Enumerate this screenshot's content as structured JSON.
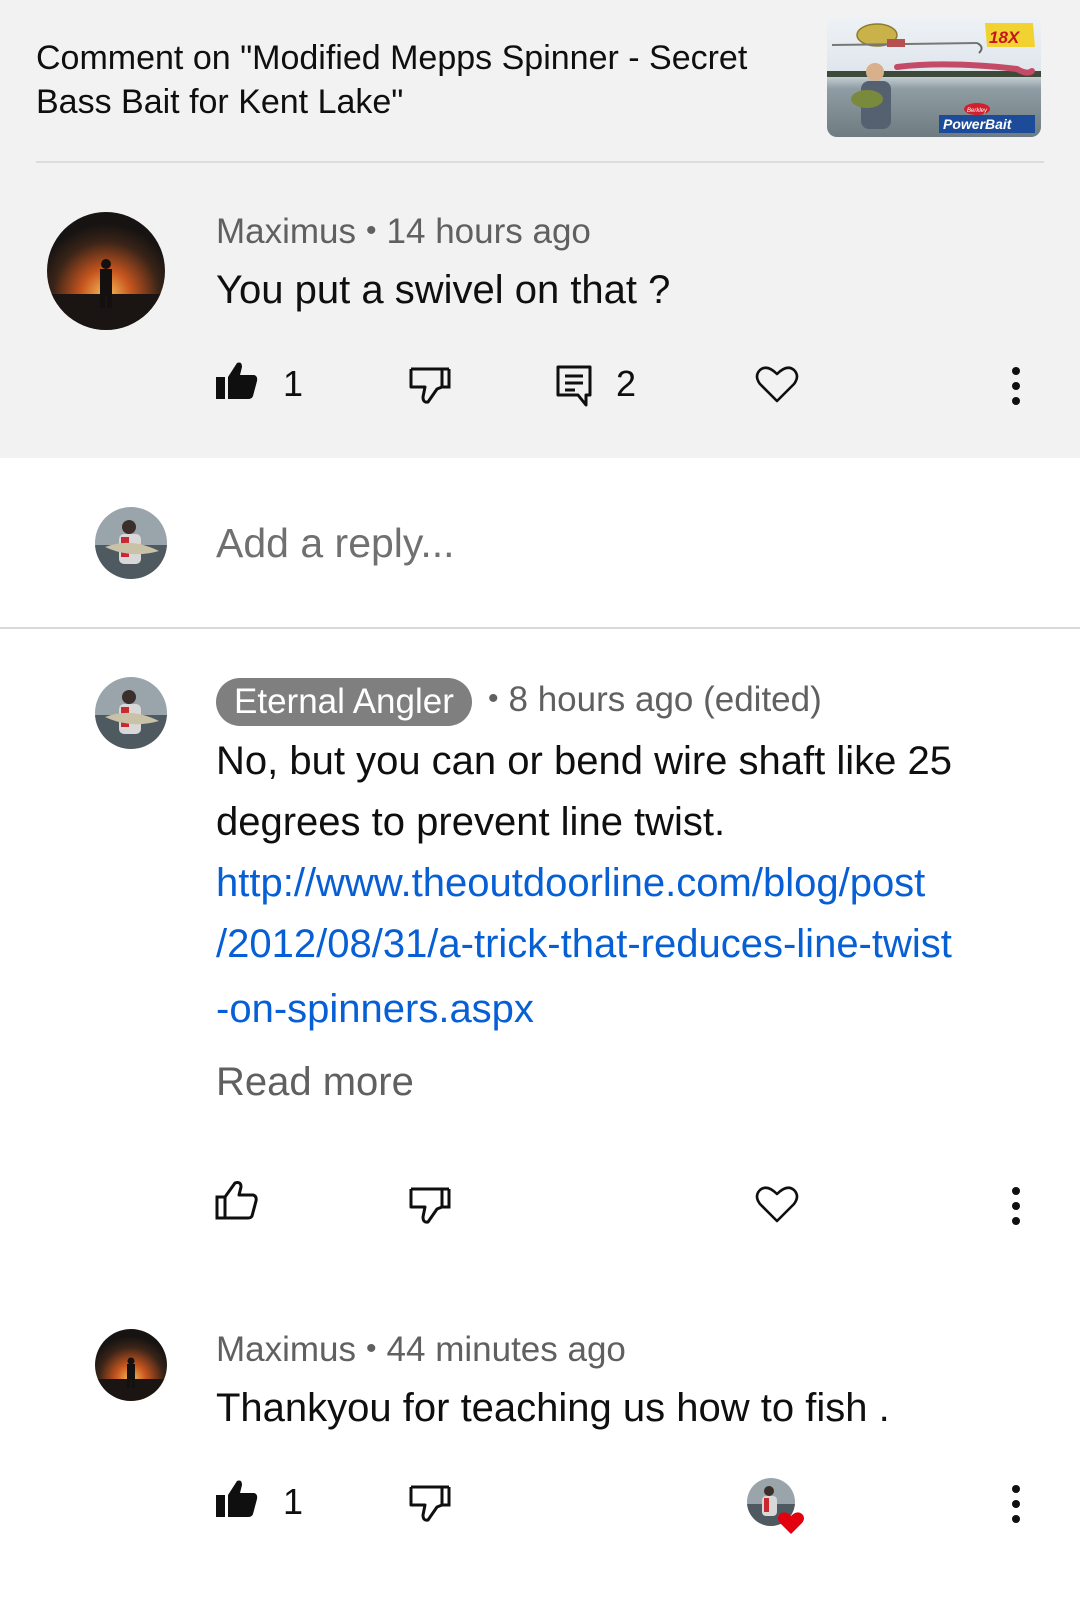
{
  "header": {
    "title": "Comment on \"Modified Mepps Spinner - Secret Bass Bait for Kent Lake\"",
    "thumbnail": {
      "badge": "18X",
      "brand": "PowerBait",
      "brand_small": "Berkley"
    }
  },
  "comment": {
    "author": "Maximus",
    "time": "14 hours ago",
    "text": "You put a swivel on that ?",
    "likes": "1",
    "replies": "2"
  },
  "reply_box": {
    "placeholder": "Add a reply..."
  },
  "replies": [
    {
      "author": "Eternal Angler",
      "time": "8 hours ago (edited)",
      "text": "No, but you can or bend wire shaft like 25 degrees to prevent line twist.",
      "link_lines": [
        "http://www.theoutdoorline.com/blog/post",
        "/2012/08/31/a-trick-that-reduces-line-twist",
        "-on-spinners.aspx"
      ],
      "read_more": "Read more"
    },
    {
      "author": "Maximus",
      "time": "44 minutes ago",
      "text": "Thankyou for teaching us how to fish .",
      "likes": "1"
    }
  ],
  "colors": {
    "link": "#065fd4",
    "heart": "#e3000f",
    "chip": "#7f7f7f"
  },
  "icons": [
    "thumb-up-filled-icon",
    "thumb-down-icon",
    "comment-icon",
    "heart-icon",
    "more-vert-icon",
    "thumb-up-outline-icon"
  ]
}
